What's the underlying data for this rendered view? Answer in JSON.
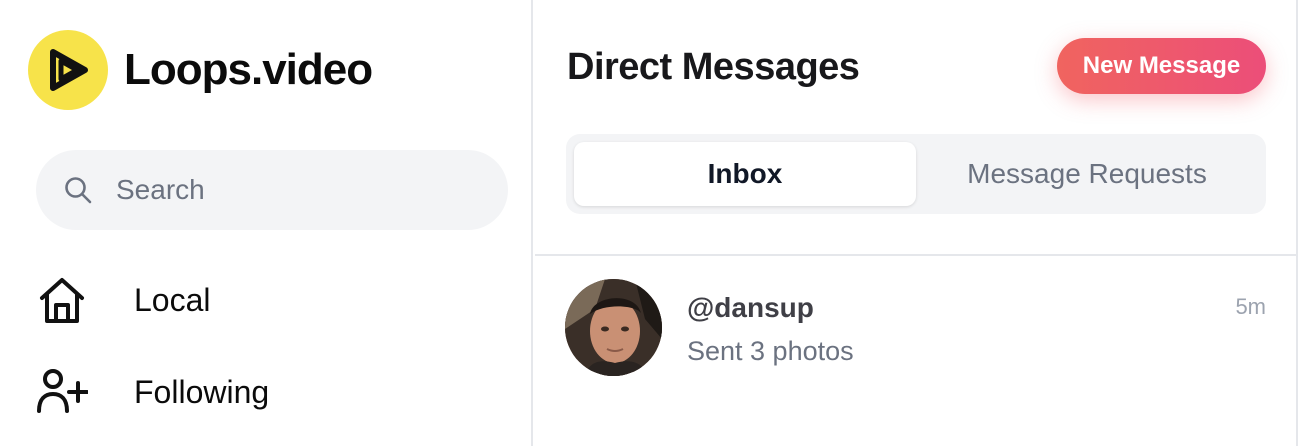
{
  "sidebar": {
    "brand_name": "Loops.video",
    "logo_icon": "play-logo-icon",
    "brand_color": "#f7e34a",
    "search": {
      "placeholder": "Search",
      "icon": "search-icon"
    },
    "nav": [
      {
        "label": "Local",
        "icon": "home-icon"
      },
      {
        "label": "Following",
        "icon": "user-plus-icon"
      }
    ]
  },
  "main": {
    "title": "Direct Messages",
    "new_message_label": "New Message",
    "accent_gradient": [
      "#f0645f",
      "#ec4e79"
    ],
    "tabs": [
      {
        "label": "Inbox",
        "active": true
      },
      {
        "label": "Message Requests",
        "active": false
      }
    ],
    "conversations": [
      {
        "username": "@dansup",
        "preview": "Sent 3 photos",
        "time": "5m",
        "avatar": "user-avatar"
      }
    ]
  }
}
